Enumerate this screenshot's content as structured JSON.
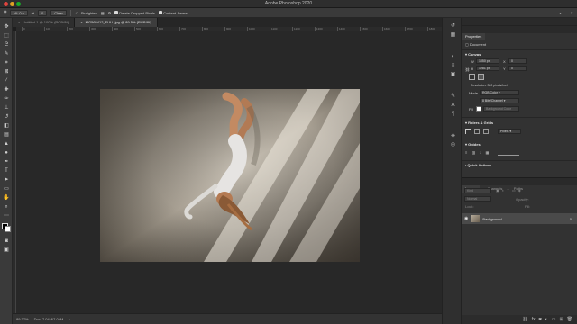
{
  "window": {
    "title": "Adobe Photoshop 2020"
  },
  "options_bar": {
    "w": "W:",
    "ratio": "0",
    "ratio_x": "0",
    "clear": "Clear",
    "straighten": "Straighten",
    "delete_cropped": "Delete Cropped Pixels",
    "content_aware": "Content-Aware"
  },
  "tabs": [
    {
      "label": "Untitled-1 @ 100% (RGB/8*)"
    },
    {
      "label": "MG565412_FULL.jpg @ 89.5% (RGB/8*)"
    }
  ],
  "ruler": {
    "labels": [
      "0",
      "100",
      "200",
      "300",
      "400",
      "500",
      "600",
      "700",
      "800",
      "900",
      "1000",
      "1100",
      "1200",
      "1300",
      "1400",
      "1500",
      "1600",
      "1700",
      "1800"
    ]
  },
  "status": {
    "zoom": "89.37%",
    "doc": "Doc: 7.04M/7.04M"
  },
  "panel": {
    "top_tab": "Info",
    "properties_tab": "Properties",
    "document": "Document",
    "canvas_title": "Canvas",
    "w_label": "W",
    "w_value": "1050 px",
    "h_label": "H",
    "h_value": "1281 px",
    "x_label": "X",
    "x_value": "0",
    "y_label": "Y",
    "y_value": "0",
    "resolution": "Resolution: 300 pixels/inch",
    "mode_label": "Mode",
    "mode_value": "RGB Color",
    "bits": "8 Bits/Channel",
    "fill_label": "Fill",
    "fill_value": "Background Color",
    "rulers_title": "Rulers & Grids",
    "units": "Pixels",
    "guides_title": "Guides",
    "quick_actions": "Quick Actions",
    "layers_tab": "Layers",
    "channels_tab": "Channels",
    "paths_tab": "Paths",
    "kind": "Kind",
    "normal": "Normal",
    "opacity": "Opacity:",
    "lock": "Lock:",
    "fill": "Fill:",
    "layer_name": "Background"
  },
  "colors": {
    "accent": "#2a7fd8",
    "ui_dark": "#323232"
  }
}
